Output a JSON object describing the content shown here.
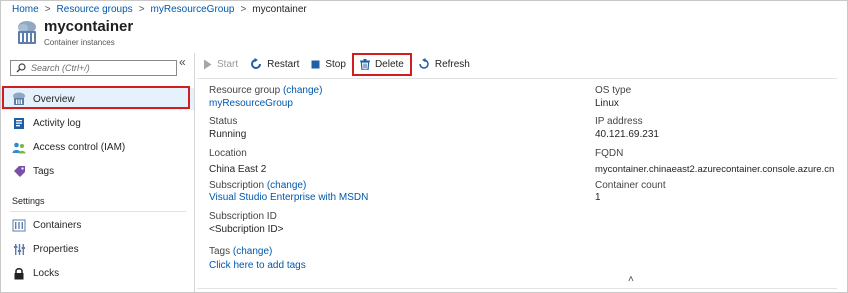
{
  "breadcrumb": {
    "home": "Home",
    "resource_groups": "Resource groups",
    "resource_group": "myResourceGroup",
    "current": "mycontainer",
    "separator": ">"
  },
  "header": {
    "title": "mycontainer",
    "subtitle": "Container instances"
  },
  "sidebar": {
    "search_placeholder": "Search (Ctrl+/)",
    "collapse_icon": "«",
    "items": [
      {
        "label": "Overview",
        "icon": "cloud-container-icon"
      },
      {
        "label": "Activity log",
        "icon": "activity-log-icon"
      },
      {
        "label": "Access control (IAM)",
        "icon": "people-icon"
      },
      {
        "label": "Tags",
        "icon": "tag-icon"
      }
    ],
    "settings_heading": "Settings",
    "settings_items": [
      {
        "label": "Containers",
        "icon": "containers-icon"
      },
      {
        "label": "Properties",
        "icon": "properties-icon"
      },
      {
        "label": "Locks",
        "icon": "lock-icon"
      }
    ]
  },
  "toolbar": {
    "start": "Start",
    "restart": "Restart",
    "stop": "Stop",
    "delete": "Delete",
    "refresh": "Refresh"
  },
  "essentials": {
    "left": {
      "resource_group_label": "Resource group",
      "resource_group_change": "(change)",
      "resource_group_value": "myResourceGroup",
      "status_label": "Status",
      "status_value": "Running",
      "location_label": "Location",
      "location_value": "China East 2",
      "subscription_label": "Subscription",
      "subscription_change": "(change)",
      "subscription_value": "Visual Studio Enterprise with MSDN",
      "subscription_id_label": "Subscription ID",
      "subscription_id_value": "<Subcription ID>",
      "tags_label": "Tags",
      "tags_change": "(change)",
      "tags_value": "Click here to add tags"
    },
    "right": {
      "os_type_label": "OS type",
      "os_type_value": "Linux",
      "ip_label": "IP address",
      "ip_value": "40.121.69.231",
      "fqdn_label": "FQDN",
      "fqdn_value": "mycontainer.chinaeast2.azurecontainer.console.azure.cn",
      "container_count_label": "Container count",
      "container_count_value": "1"
    },
    "collapse_glyph": "˄"
  },
  "colors": {
    "accent_link": "#0058ad",
    "highlight_border": "#d11f1f",
    "selected_bg": "#e5f1fb"
  }
}
